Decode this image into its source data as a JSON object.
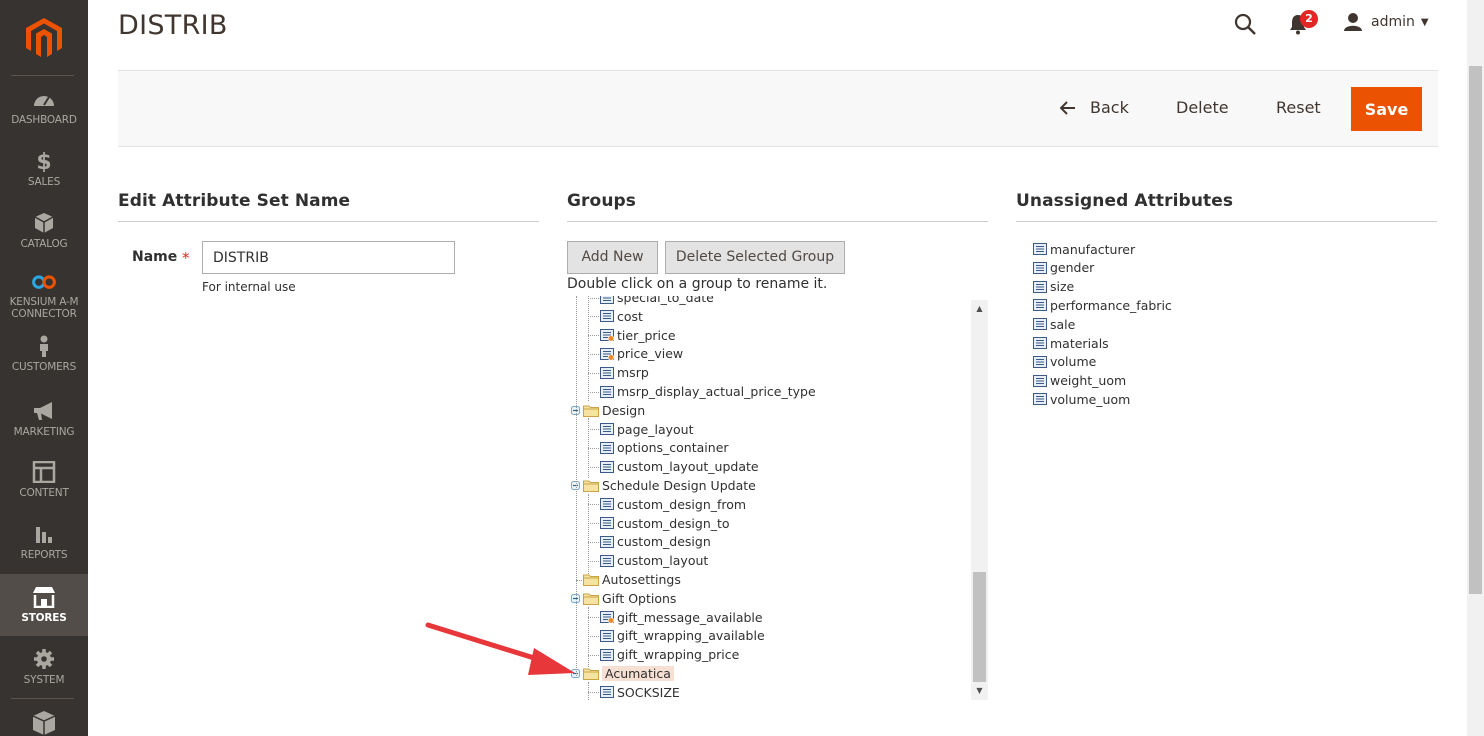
{
  "sidebar": {
    "items": [
      {
        "label": "DASHBOARD",
        "icon": "dashboard-icon"
      },
      {
        "label": "SALES",
        "icon": "dollar-icon"
      },
      {
        "label": "CATALOG",
        "icon": "box-icon"
      },
      {
        "label": "KENSIUM A-M CONNECTOR",
        "label_line1": "KENSIUM A-M",
        "label_line2": "CONNECTOR",
        "icon": "connector-icon"
      },
      {
        "label": "CUSTOMERS",
        "icon": "person-icon"
      },
      {
        "label": "MARKETING",
        "icon": "megaphone-icon"
      },
      {
        "label": "CONTENT",
        "icon": "layout-icon"
      },
      {
        "label": "REPORTS",
        "icon": "bar-chart-icon"
      },
      {
        "label": "STORES",
        "icon": "store-icon"
      },
      {
        "label": "SYSTEM",
        "icon": "gear-icon"
      }
    ]
  },
  "header": {
    "title": "DISTRIB",
    "notifications_count": "2",
    "user": "admin"
  },
  "actions": {
    "back": "Back",
    "delete": "Delete",
    "reset": "Reset",
    "save": "Save"
  },
  "edit_section": {
    "title": "Edit Attribute Set Name",
    "name_label": "Name",
    "required_mark": "*",
    "name_value": "DISTRIB",
    "note": "For internal use"
  },
  "groups_section": {
    "title": "Groups",
    "add_new": "Add New",
    "delete_group": "Delete Selected Group",
    "hint": "Double click on a group to rename it.",
    "tree": [
      {
        "type": "leaf",
        "label": "special_to_date",
        "partial": true
      },
      {
        "type": "leaf",
        "label": "cost"
      },
      {
        "type": "leaf",
        "label": "tier_price",
        "system": true
      },
      {
        "type": "leaf",
        "label": "price_view",
        "system": true
      },
      {
        "type": "leaf",
        "label": "msrp"
      },
      {
        "type": "leaf",
        "label": "msrp_display_actual_price_type"
      },
      {
        "type": "group",
        "label": "Design"
      },
      {
        "type": "leaf",
        "label": "page_layout"
      },
      {
        "type": "leaf",
        "label": "options_container"
      },
      {
        "type": "leaf",
        "label": "custom_layout_update"
      },
      {
        "type": "group",
        "label": "Schedule Design Update"
      },
      {
        "type": "leaf",
        "label": "custom_design_from"
      },
      {
        "type": "leaf",
        "label": "custom_design_to"
      },
      {
        "type": "leaf",
        "label": "custom_design"
      },
      {
        "type": "leaf",
        "label": "custom_layout"
      },
      {
        "type": "group",
        "label": "Autosettings",
        "empty": true
      },
      {
        "type": "group",
        "label": "Gift Options"
      },
      {
        "type": "leaf",
        "label": "gift_message_available",
        "system": true
      },
      {
        "type": "leaf",
        "label": "gift_wrapping_available"
      },
      {
        "type": "leaf",
        "label": "gift_wrapping_price"
      },
      {
        "type": "group",
        "label": "Acumatica",
        "selected": true
      },
      {
        "type": "leaf",
        "label": "SOCKSIZE"
      }
    ]
  },
  "unassigned_section": {
    "title": "Unassigned Attributes",
    "items": [
      "manufacturer",
      "gender",
      "size",
      "performance_fabric",
      "sale",
      "materials",
      "volume",
      "weight_uom",
      "volume_uom"
    ]
  },
  "colors": {
    "accent": "#eb5202",
    "sidebar": "#373330",
    "annotation_arrow": "#e8373a"
  }
}
